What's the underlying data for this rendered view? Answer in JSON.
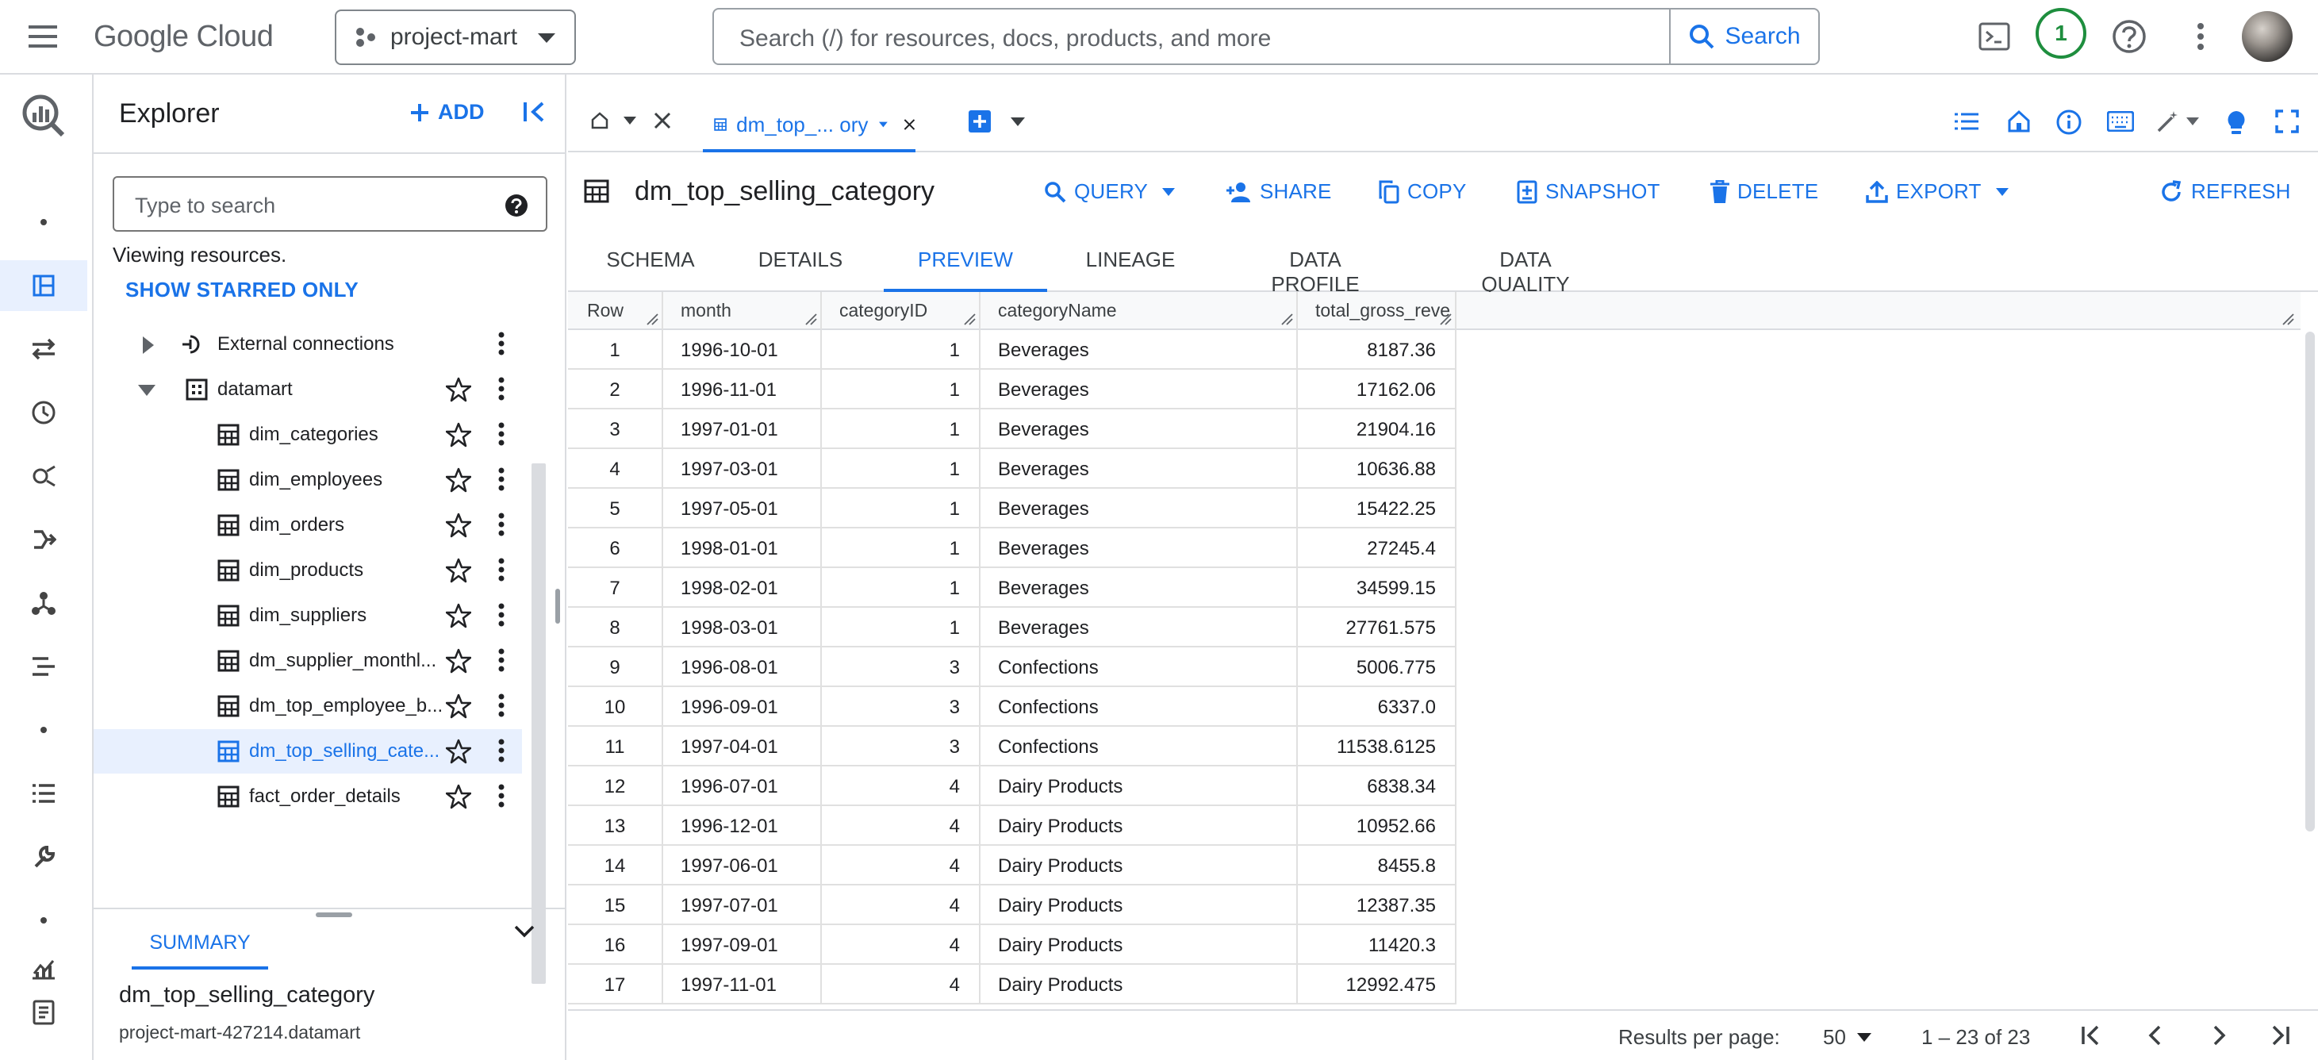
{
  "topbar": {
    "logo_google": "Google",
    "logo_cloud": "Cloud",
    "project": "project-mart",
    "search_placeholder": "Search (/) for resources, docs, products, and more",
    "search_button": "Search",
    "notification_count": "1"
  },
  "explorer": {
    "title": "Explorer",
    "add_label": "ADD",
    "search_placeholder": "Type to search",
    "viewing": "Viewing resources.",
    "show_starred": "SHOW STARRED ONLY",
    "tree": [
      {
        "label": "External connections",
        "type": "connections"
      },
      {
        "label": "datamart",
        "type": "dataset"
      },
      {
        "label": "dim_categories",
        "type": "table"
      },
      {
        "label": "dim_employees",
        "type": "table"
      },
      {
        "label": "dim_orders",
        "type": "table"
      },
      {
        "label": "dim_products",
        "type": "table"
      },
      {
        "label": "dim_suppliers",
        "type": "table"
      },
      {
        "label": "dm_supplier_monthl...",
        "type": "table"
      },
      {
        "label": "dm_top_employee_b...",
        "type": "table"
      },
      {
        "label": "dm_top_selling_cate...",
        "type": "table",
        "selected": true
      },
      {
        "label": "fact_order_details",
        "type": "table"
      }
    ],
    "summary_tab": "SUMMARY",
    "summary_name": "dm_top_selling_category",
    "summary_path": "project-mart-427214.datamart"
  },
  "tabs": {
    "active_tab": "dm_top_... ory"
  },
  "toolbar": {
    "title": "dm_top_selling_category",
    "query": "QUERY",
    "share": "SHARE",
    "copy": "COPY",
    "snapshot": "SNAPSHOT",
    "delete": "DELETE",
    "export": "EXPORT",
    "refresh": "REFRESH"
  },
  "subtabs": [
    "SCHEMA",
    "DETAILS",
    "PREVIEW",
    "LINEAGE",
    "DATA PROFILE",
    "DATA QUALITY"
  ],
  "active_subtab": "PREVIEW",
  "grid": {
    "columns": [
      "Row",
      "month",
      "categoryID",
      "categoryName",
      "total_gross_reve"
    ],
    "rows": [
      [
        "1",
        "1996-10-01",
        "1",
        "Beverages",
        "8187.36"
      ],
      [
        "2",
        "1996-11-01",
        "1",
        "Beverages",
        "17162.06"
      ],
      [
        "3",
        "1997-01-01",
        "1",
        "Beverages",
        "21904.16"
      ],
      [
        "4",
        "1997-03-01",
        "1",
        "Beverages",
        "10636.88"
      ],
      [
        "5",
        "1997-05-01",
        "1",
        "Beverages",
        "15422.25"
      ],
      [
        "6",
        "1998-01-01",
        "1",
        "Beverages",
        "27245.4"
      ],
      [
        "7",
        "1998-02-01",
        "1",
        "Beverages",
        "34599.15"
      ],
      [
        "8",
        "1998-03-01",
        "1",
        "Beverages",
        "27761.575"
      ],
      [
        "9",
        "1996-08-01",
        "3",
        "Confections",
        "5006.775"
      ],
      [
        "10",
        "1996-09-01",
        "3",
        "Confections",
        "6337.0"
      ],
      [
        "11",
        "1997-04-01",
        "3",
        "Confections",
        "11538.6125"
      ],
      [
        "12",
        "1996-07-01",
        "4",
        "Dairy Products",
        "6838.34"
      ],
      [
        "13",
        "1996-12-01",
        "4",
        "Dairy Products",
        "10952.66"
      ],
      [
        "14",
        "1997-06-01",
        "4",
        "Dairy Products",
        "8455.8"
      ],
      [
        "15",
        "1997-07-01",
        "4",
        "Dairy Products",
        "12387.35"
      ],
      [
        "16",
        "1997-09-01",
        "4",
        "Dairy Products",
        "11420.3"
      ],
      [
        "17",
        "1997-11-01",
        "4",
        "Dairy Products",
        "12992.475"
      ]
    ]
  },
  "footer": {
    "results_per_page_label": "Results per page:",
    "results_per_page": "50",
    "range": "1 – 23 of 23"
  },
  "colors": {
    "accent": "#1a73e8",
    "selected_bg": "#e8f0fe",
    "badge": "#1e8e3e"
  }
}
